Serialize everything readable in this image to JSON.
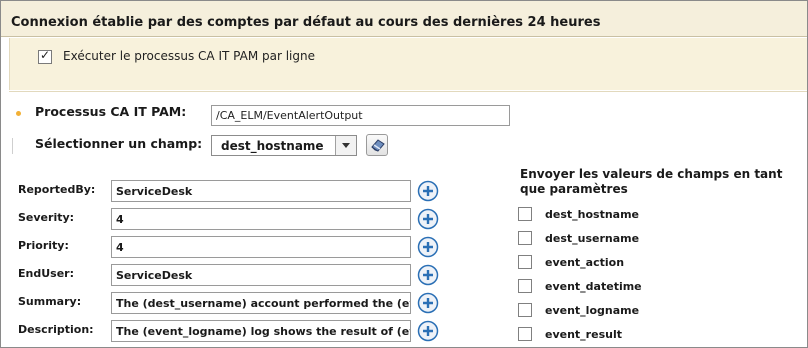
{
  "header": {
    "title": "Connexion établie par des comptes par défaut au cours des dernières 24 heures"
  },
  "options": {
    "per_row_label": "Exécuter le processus CA IT PAM par ligne",
    "per_row_checked": true
  },
  "process": {
    "label": "Processus CA IT PAM:",
    "value": "/CA_ELM/EventAlertOutput"
  },
  "field_selector": {
    "label": "Sélectionner un champ:",
    "selected": "dest_hostname"
  },
  "params": [
    {
      "label": "ReportedBy:",
      "value": "ServiceDesk"
    },
    {
      "label": "Severity:",
      "value": "4"
    },
    {
      "label": "Priority:",
      "value": "4"
    },
    {
      "label": "EndUser:",
      "value": "ServiceDesk"
    },
    {
      "label": "Summary:",
      "value": "The  (dest_username) account performed the (event_"
    },
    {
      "label": "Description:",
      "value": "The (event_logname) log shows the result of (event_"
    }
  ],
  "send_fields": {
    "title": "Envoyer les valeurs de champs en tant que paramètres",
    "items": [
      {
        "label": "dest_hostname",
        "checked": false
      },
      {
        "label": "dest_username",
        "checked": false
      },
      {
        "label": "event_action",
        "checked": false
      },
      {
        "label": "event_datetime",
        "checked": false
      },
      {
        "label": "event_logname",
        "checked": false
      },
      {
        "label": "event_result",
        "checked": false
      }
    ]
  },
  "colors": {
    "header_bg": "#f5efdc",
    "required_dot": "#f2b035",
    "add_button": "#2a6fb5"
  }
}
